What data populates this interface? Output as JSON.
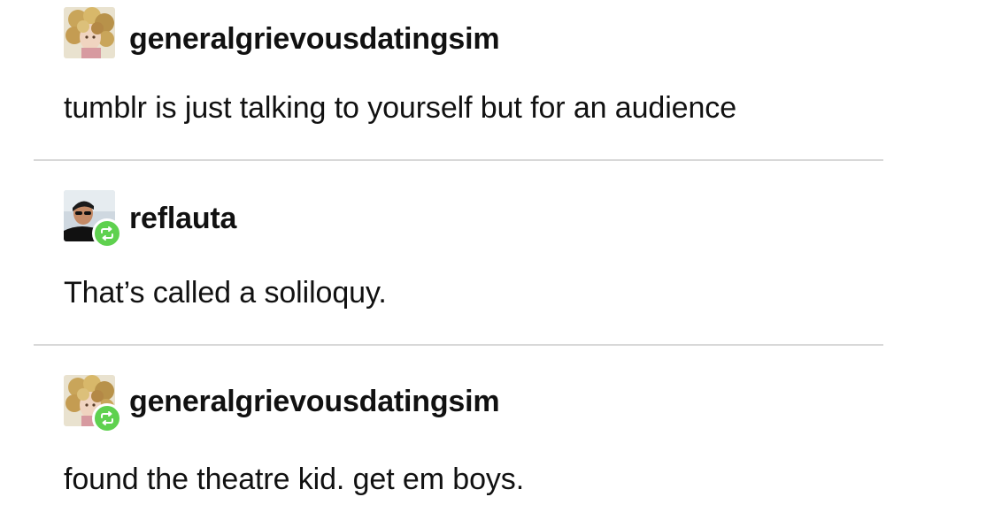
{
  "thread": {
    "posts": [
      {
        "username": "generalgrievousdatingsim",
        "text": "tumblr is just talking to yourself but for an audience",
        "reblogged": false,
        "avatar_icon": "curly-hair-avatar"
      },
      {
        "username": "reflauta",
        "text": "That’s called a soliloquy.",
        "reblogged": true,
        "avatar_icon": "sunglasses-person-avatar"
      },
      {
        "username": "generalgrievousdatingsim",
        "text": "found the theatre kid. get em boys.",
        "reblogged": true,
        "avatar_icon": "curly-hair-avatar"
      }
    ]
  },
  "colors": {
    "text": "#111111",
    "divider": "#d8d8d8",
    "reblog_badge": "#5fd14f"
  }
}
